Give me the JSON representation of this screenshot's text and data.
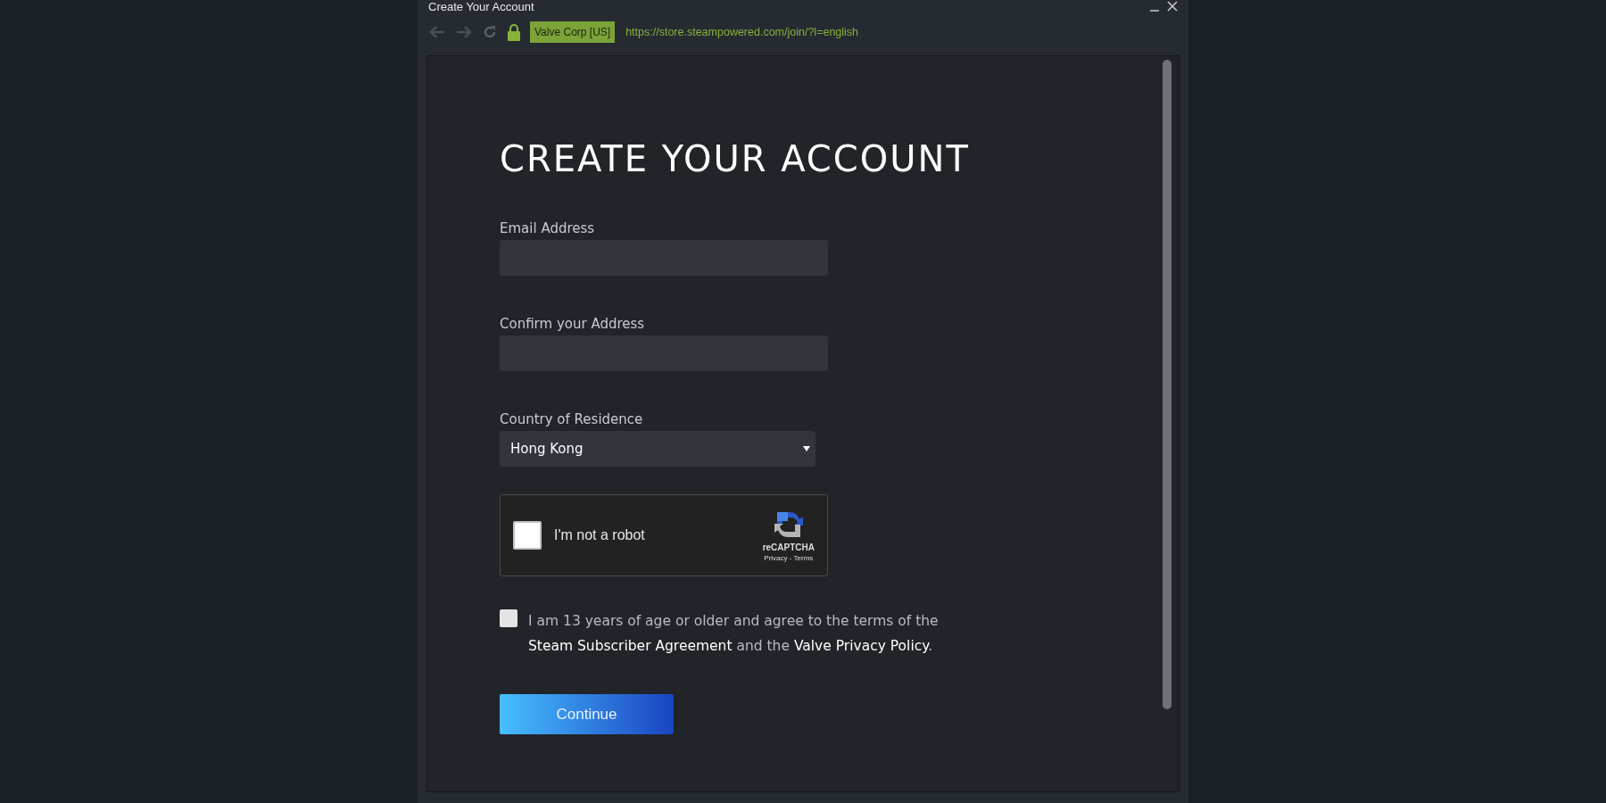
{
  "window": {
    "title": "Create Your Account"
  },
  "toolbar": {
    "site_badge": "Valve Corp [US]",
    "url": "https://store.steampowered.com/join/?l=english"
  },
  "form": {
    "heading": "CREATE YOUR ACCOUNT",
    "fields": [
      {
        "kind": "text",
        "label": "Email Address"
      },
      {
        "kind": "text",
        "label": "Confirm your Address"
      },
      {
        "kind": "select",
        "label": "Country of Residence",
        "value": "Hong Kong"
      }
    ],
    "captcha": {
      "checked": false,
      "label": "I'm not a robot",
      "brand": "reCAPTCHA",
      "links": "Privacy - Terms"
    },
    "agreement": {
      "checked": false,
      "parts": [
        {
          "kind": "text",
          "text": "I am 13 years of age or older and agree to the terms of the "
        },
        {
          "kind": "link",
          "text": "Steam Subscriber Agreement"
        },
        {
          "kind": "text",
          "text": " and the "
        },
        {
          "kind": "link",
          "text": "Valve Privacy Policy"
        },
        {
          "kind": "text",
          "text": "."
        }
      ]
    },
    "submit": "Continue"
  }
}
